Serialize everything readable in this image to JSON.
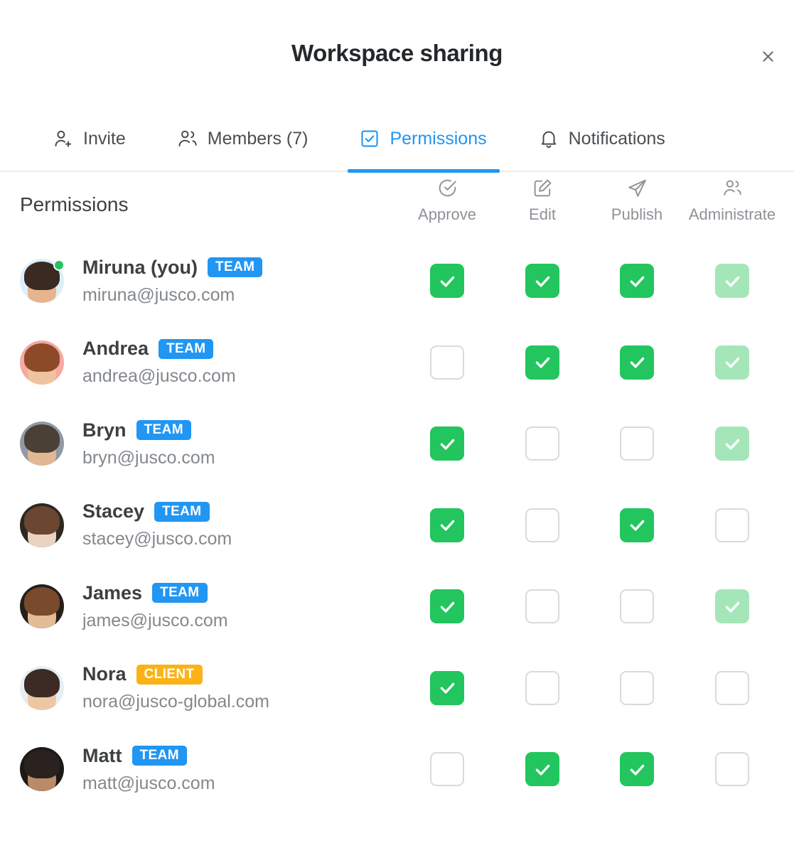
{
  "header": {
    "title": "Workspace sharing",
    "close_icon": "close-icon"
  },
  "tabs": [
    {
      "label": "Invite",
      "icon": "user-add-icon",
      "active": false
    },
    {
      "label": "Members (7)",
      "icon": "users-icon",
      "active": false
    },
    {
      "label": "Permissions",
      "icon": "checkbox-icon",
      "active": true
    },
    {
      "label": "Notifications",
      "icon": "bell-icon",
      "active": false
    }
  ],
  "section": {
    "title": "Permissions"
  },
  "columns": [
    {
      "label": "Approve",
      "icon": "check-circle-icon"
    },
    {
      "label": "Edit",
      "icon": "pencil-square-icon"
    },
    {
      "label": "Publish",
      "icon": "paper-plane-icon"
    },
    {
      "label": "Administrate",
      "icon": "users-icon"
    }
  ],
  "colors": {
    "accent": "#2196f3",
    "check_on": "#22c55e",
    "check_on_light": "#a5e6b9",
    "check_off_border": "#d8dadc",
    "badge_team": "#2196f3",
    "badge_client": "#fbb216",
    "status_online": "#22c55e"
  },
  "members": [
    {
      "name": "Miruna (you)",
      "badge": "TEAM",
      "badge_type": "team",
      "email": "miruna@jusco.com",
      "online": true,
      "avatar_bg": "#ddeefb",
      "avatar_hair": "#3a2a22",
      "avatar_skin": "#e6b48f",
      "permissions": [
        "on",
        "on",
        "on",
        "on-light"
      ]
    },
    {
      "name": "Andrea",
      "badge": "TEAM",
      "badge_type": "team",
      "email": "andrea@jusco.com",
      "online": false,
      "avatar_bg": "#f5a9a0",
      "avatar_hair": "#8c4a28",
      "avatar_skin": "#f0c3a0",
      "permissions": [
        "off",
        "on",
        "on",
        "on-light"
      ]
    },
    {
      "name": "Bryn",
      "badge": "TEAM",
      "badge_type": "team",
      "email": "bryn@jusco.com",
      "online": false,
      "avatar_bg": "#8f9aa6",
      "avatar_hair": "#4a4036",
      "avatar_skin": "#e0b893",
      "permissions": [
        "on",
        "off",
        "off",
        "on-light"
      ]
    },
    {
      "name": "Stacey",
      "badge": "TEAM",
      "badge_type": "team",
      "email": "stacey@jusco.com",
      "online": false,
      "avatar_bg": "#2d2722",
      "avatar_hair": "#6b4630",
      "avatar_skin": "#ead3c0",
      "permissions": [
        "on",
        "off",
        "on",
        "off"
      ]
    },
    {
      "name": "James",
      "badge": "TEAM",
      "badge_type": "team",
      "email": "james@jusco.com",
      "online": false,
      "avatar_bg": "#241f1b",
      "avatar_hair": "#7a4a2c",
      "avatar_skin": "#e3bb96",
      "permissions": [
        "on",
        "off",
        "off",
        "on-light"
      ]
    },
    {
      "name": "Nora",
      "badge": "CLIENT",
      "badge_type": "client",
      "email": "nora@jusco-global.com",
      "online": false,
      "avatar_bg": "#e7eef3",
      "avatar_hair": "#3b2b24",
      "avatar_skin": "#edc6a4",
      "permissions": [
        "on",
        "off",
        "off",
        "off"
      ]
    },
    {
      "name": "Matt",
      "badge": "TEAM",
      "badge_type": "team",
      "email": "matt@jusco.com",
      "online": false,
      "avatar_bg": "#1c1917",
      "avatar_hair": "#2b2220",
      "avatar_skin": "#b98b68",
      "permissions": [
        "off",
        "on",
        "on",
        "off"
      ]
    }
  ]
}
